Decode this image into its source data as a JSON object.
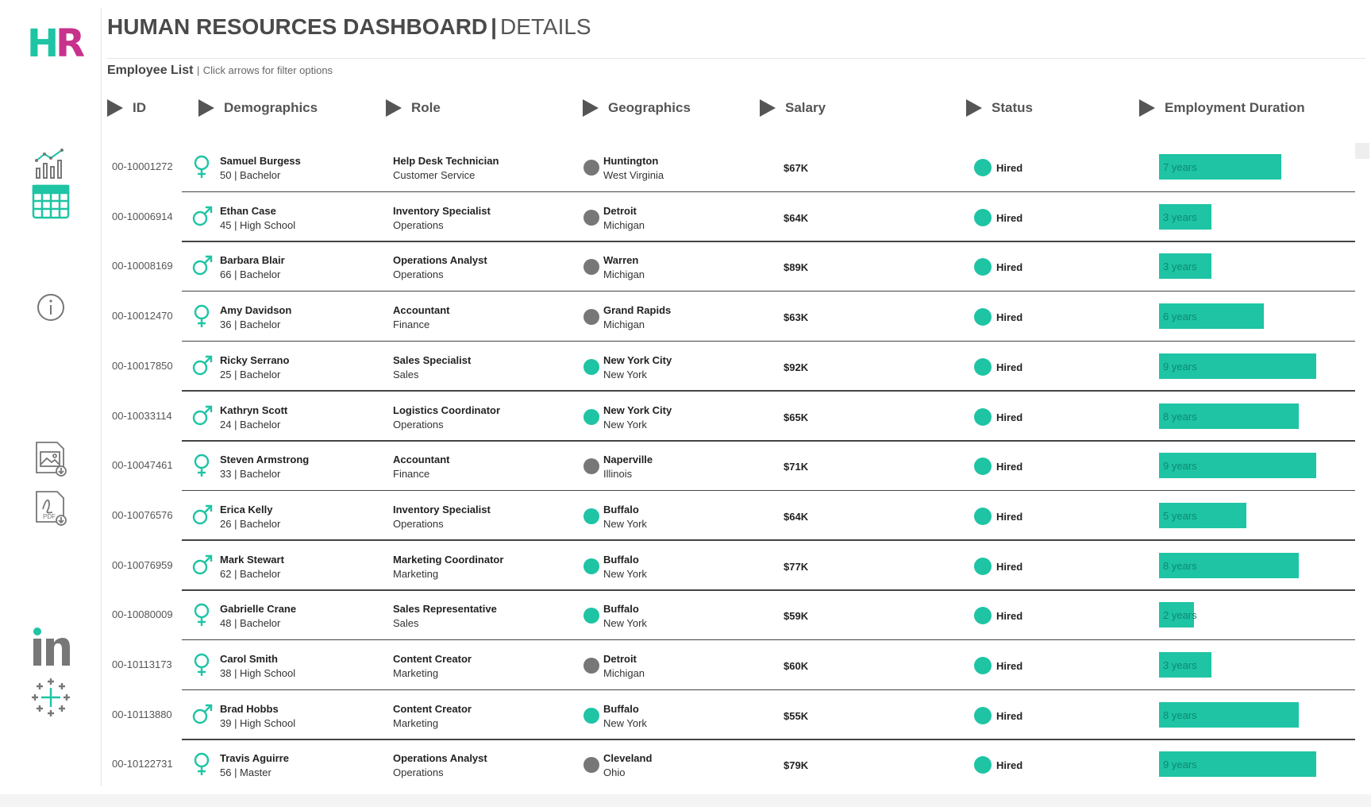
{
  "brand": {
    "logo_h": "H",
    "logo_r": "R"
  },
  "header": {
    "title": "HUMAN RESOURCES DASHBOARD",
    "separator": "|",
    "subtitle": "DETAILS"
  },
  "list": {
    "label": "Employee List",
    "separator": "|",
    "hint": "Click arrows for filter options"
  },
  "columns": [
    {
      "label": "ID"
    },
    {
      "label": "Demographics"
    },
    {
      "label": "Role"
    },
    {
      "label": "Geographics"
    },
    {
      "label": "Salary"
    },
    {
      "label": "Status"
    },
    {
      "label": "Employment Duration"
    }
  ],
  "sidebar": {
    "icons": [
      "overview-chart-icon",
      "details-table-icon",
      "info-icon",
      "image-download-icon",
      "pdf-download-icon",
      "linkedin-icon",
      "tableau-icon"
    ]
  },
  "colors": {
    "accent": "#1ec4a4",
    "female": "#1ec4a4",
    "gray_dot": "#777777",
    "bar": "#1ec4a4"
  },
  "employees": [
    {
      "id": "00-10001272",
      "gender": "female",
      "name": "Samuel Burgess",
      "age_edu": "50 | Bachelor",
      "title": "Help Desk Technician",
      "dept": "Customer Service",
      "geo_dot": "gray",
      "city": "Huntington",
      "state": "West Virginia",
      "salary": "$67K",
      "status": "Hired",
      "duration": "7 years",
      "years": 7
    },
    {
      "id": "00-10006914",
      "gender": "male",
      "name": "Ethan Case",
      "age_edu": "45 | High School",
      "title": "Inventory Specialist",
      "dept": "Operations",
      "geo_dot": "gray",
      "city": "Detroit",
      "state": "Michigan",
      "salary": "$64K",
      "status": "Hired",
      "duration": "3 years",
      "years": 3
    },
    {
      "id": "00-10008169",
      "gender": "male",
      "name": "Barbara Blair",
      "age_edu": "66 | Bachelor",
      "title": "Operations Analyst",
      "dept": "Operations",
      "geo_dot": "gray",
      "city": "Warren",
      "state": "Michigan",
      "salary": "$89K",
      "status": "Hired",
      "duration": "3 years",
      "years": 3
    },
    {
      "id": "00-10012470",
      "gender": "female",
      "name": "Amy Davidson",
      "age_edu": "36 | Bachelor",
      "title": "Accountant",
      "dept": "Finance",
      "geo_dot": "gray",
      "city": "Grand Rapids",
      "state": "Michigan",
      "salary": "$63K",
      "status": "Hired",
      "duration": "6 years",
      "years": 6
    },
    {
      "id": "00-10017850",
      "gender": "male",
      "name": "Ricky Serrano",
      "age_edu": "25 | Bachelor",
      "title": "Sales Specialist",
      "dept": "Sales",
      "geo_dot": "teal",
      "city": "New York City",
      "state": "New York",
      "salary": "$92K",
      "status": "Hired",
      "duration": "9 years",
      "years": 9
    },
    {
      "id": "00-10033114",
      "gender": "male",
      "name": "Kathryn Scott",
      "age_edu": "24 | Bachelor",
      "title": "Logistics Coordinator",
      "dept": "Operations",
      "geo_dot": "teal",
      "city": "New York City",
      "state": "New York",
      "salary": "$65K",
      "status": "Hired",
      "duration": "8 years",
      "years": 8
    },
    {
      "id": "00-10047461",
      "gender": "female",
      "name": "Steven Armstrong",
      "age_edu": "33 | Bachelor",
      "title": "Accountant",
      "dept": "Finance",
      "geo_dot": "gray",
      "city": "Naperville",
      "state": "Illinois",
      "salary": "$71K",
      "status": "Hired",
      "duration": "9 years",
      "years": 9
    },
    {
      "id": "00-10076576",
      "gender": "male",
      "name": "Erica Kelly",
      "age_edu": "26 | Bachelor",
      "title": "Inventory Specialist",
      "dept": "Operations",
      "geo_dot": "teal",
      "city": "Buffalo",
      "state": "New York",
      "salary": "$64K",
      "status": "Hired",
      "duration": "5 years",
      "years": 5
    },
    {
      "id": "00-10076959",
      "gender": "male",
      "name": "Mark Stewart",
      "age_edu": "62 | Bachelor",
      "title": "Marketing Coordinator",
      "dept": "Marketing",
      "geo_dot": "teal",
      "city": "Buffalo",
      "state": "New York",
      "salary": "$77K",
      "status": "Hired",
      "duration": "8 years",
      "years": 8
    },
    {
      "id": "00-10080009",
      "gender": "female",
      "name": "Gabrielle Crane",
      "age_edu": "48 | Bachelor",
      "title": "Sales Representative",
      "dept": "Sales",
      "geo_dot": "teal",
      "city": "Buffalo",
      "state": "New York",
      "salary": "$59K",
      "status": "Hired",
      "duration": "2 years",
      "years": 2
    },
    {
      "id": "00-10113173",
      "gender": "female",
      "name": "Carol Smith",
      "age_edu": "38 | High School",
      "title": "Content Creator",
      "dept": "Marketing",
      "geo_dot": "gray",
      "city": "Detroit",
      "state": "Michigan",
      "salary": "$60K",
      "status": "Hired",
      "duration": "3 years",
      "years": 3
    },
    {
      "id": "00-10113880",
      "gender": "male",
      "name": "Brad Hobbs",
      "age_edu": "39 | High School",
      "title": "Content Creator",
      "dept": "Marketing",
      "geo_dot": "teal",
      "city": "Buffalo",
      "state": "New York",
      "salary": "$55K",
      "status": "Hired",
      "duration": "8 years",
      "years": 8
    },
    {
      "id": "00-10122731",
      "gender": "female",
      "name": "Travis Aguirre",
      "age_edu": "56 | Master",
      "title": "Operations Analyst",
      "dept": "Operations",
      "geo_dot": "gray",
      "city": "Cleveland",
      "state": "Ohio",
      "salary": "$79K",
      "status": "Hired",
      "duration": "9 years",
      "years": 9
    }
  ]
}
